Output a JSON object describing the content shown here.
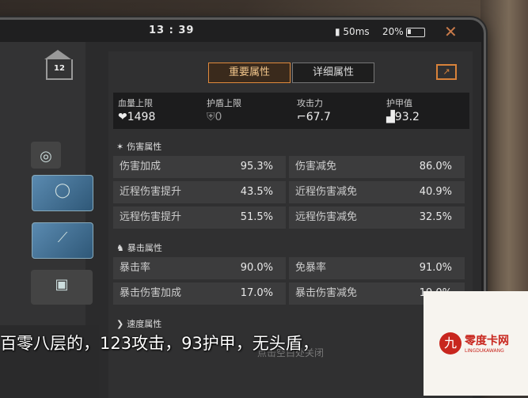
{
  "status_bar": {
    "time": "13 : 39",
    "signal": "50ms",
    "battery": "20%"
  },
  "left": {
    "level": "12"
  },
  "tabs": {
    "main": "重要属性",
    "detail": "详细属性"
  },
  "stats": [
    {
      "label": "血量上限",
      "value": "1498",
      "icon": "heart-icon"
    },
    {
      "label": "护盾上限",
      "value": "0",
      "icon": "shield-icon"
    },
    {
      "label": "攻击力",
      "value": "67.7",
      "icon": "gun-icon"
    },
    {
      "label": "护甲值",
      "value": "93.2",
      "icon": "armor-icon"
    }
  ],
  "damage": {
    "title": "伤害属性",
    "rows": [
      {
        "l1": "伤害加成",
        "v1": "95.3%",
        "l2": "伤害减免",
        "v2": "86.0%"
      },
      {
        "l1": "近程伤害提升",
        "v1": "43.5%",
        "l2": "近程伤害减免",
        "v2": "40.9%"
      },
      {
        "l1": "远程伤害提升",
        "v1": "51.5%",
        "l2": "远程伤害减免",
        "v2": "32.5%"
      }
    ]
  },
  "crit": {
    "title": "暴击属性",
    "rows": [
      {
        "l1": "暴击率",
        "v1": "90.0%",
        "l2": "免暴率",
        "v2": "91.0%"
      },
      {
        "l1": "暴击伤害加成",
        "v1": "17.0%",
        "l2": "暴击伤害减免",
        "v2": "19.0%"
      }
    ]
  },
  "speed": {
    "title": "速度属性"
  },
  "hint": "点击空白处关闭",
  "subtitle": "百零八层的，123攻击，93护甲，无头盾，",
  "watermark": {
    "name": "零度卡网",
    "sub": "LINGDUKAWANG"
  }
}
